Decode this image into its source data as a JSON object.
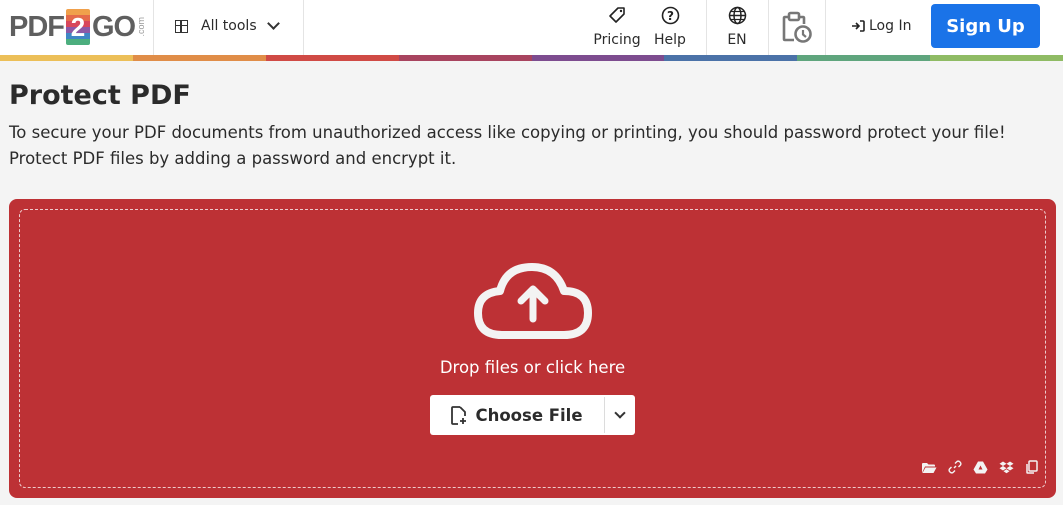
{
  "header": {
    "logo": {
      "left": "PDF",
      "badge": "2",
      "right": "GO",
      "suffix": ".com"
    },
    "all_tools_label": "All tools",
    "nav": [
      {
        "label": "Pricing",
        "icon": "tag-icon"
      },
      {
        "label": "Help",
        "icon": "help-circle-icon"
      },
      {
        "label": "EN",
        "icon": "globe-icon"
      }
    ],
    "history_icon": "clipboard-clock-icon",
    "login_label": "Log In",
    "signup_label": "Sign Up"
  },
  "colors": {
    "accent": "#1a73e8",
    "dropzone": "#bd3135",
    "rainbow": [
      "#ecbf58",
      "#e08d48",
      "#d04a45",
      "#a8445f",
      "#7d4c8f",
      "#4b72a8",
      "#5fa57d",
      "#8fbb64"
    ],
    "logo_badge": [
      "#f0a04b",
      "#e56a4a",
      "#d8475b",
      "#8c58a6",
      "#3f86c5",
      "#4cae7e"
    ]
  },
  "page": {
    "title": "Protect PDF",
    "description": "To secure your PDF documents from unauthorized access like copying or printing, you should password protect your file! Protect PDF files by adding a password and encrypt it."
  },
  "upload": {
    "drop_text": "Drop files or click here",
    "choose_file_label": "Choose File",
    "sources": [
      "folder-icon",
      "link-icon",
      "google-drive-icon",
      "dropbox-icon",
      "clipboard-copy-icon"
    ]
  }
}
